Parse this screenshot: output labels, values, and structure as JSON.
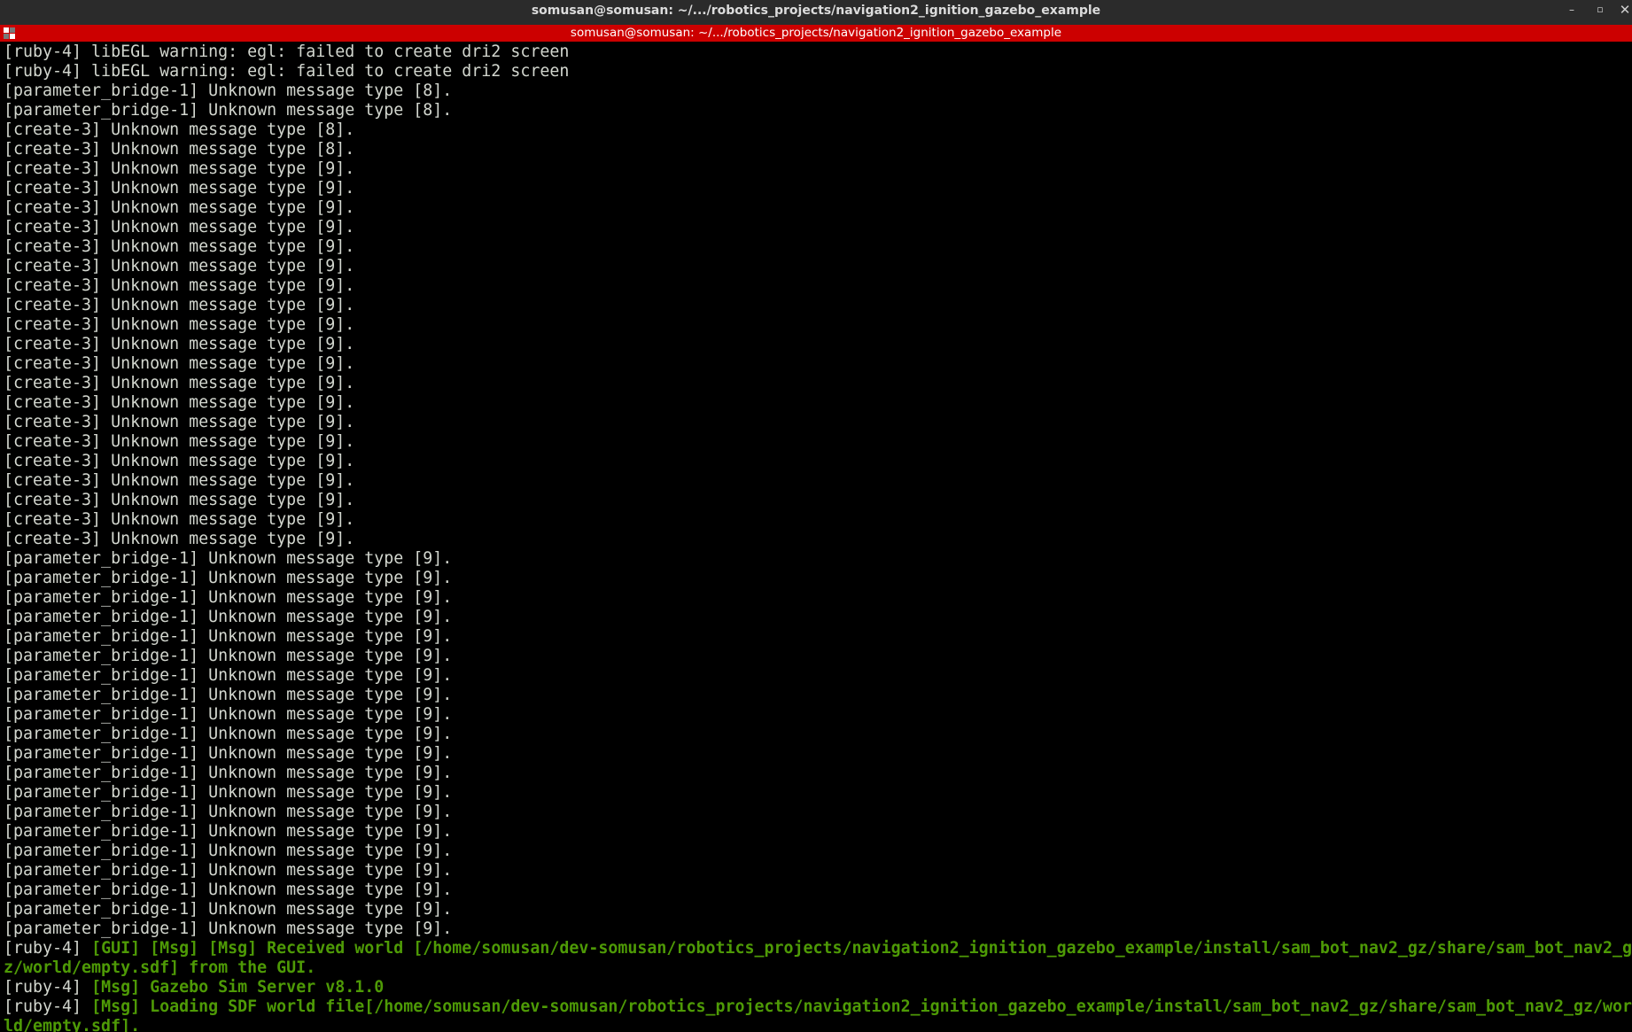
{
  "window": {
    "title": "somusan@somusan: ~/.../robotics_projects/navigation2_ignition_gazebo_example",
    "controls": {
      "minimize_icon": "–",
      "maximize_icon": "▫",
      "close_icon": "✕"
    }
  },
  "tab": {
    "title": "somusan@somusan: ~/.../robotics_projects/navigation2_ignition_gazebo_example",
    "icon": "terminal-icon"
  },
  "colors": {
    "background": "#000000",
    "tab_bar": "#cc0000",
    "text": "#d3d7cf",
    "highlight": "#4e9a06"
  },
  "log_lines": [
    [
      {
        "t": "[ruby-4] libEGL warning: egl: failed to create dri2 screen",
        "c": "plain"
      }
    ],
    [
      {
        "t": "[ruby-4] libEGL warning: egl: failed to create dri2 screen",
        "c": "plain"
      }
    ],
    [
      {
        "t": "[parameter_bridge-1] Unknown message type [8].",
        "c": "plain"
      }
    ],
    [
      {
        "t": "[parameter_bridge-1] Unknown message type [8].",
        "c": "plain"
      }
    ],
    [
      {
        "t": "[create-3] Unknown message type [8].",
        "c": "plain"
      }
    ],
    [
      {
        "t": "[create-3] Unknown message type [8].",
        "c": "plain"
      }
    ],
    [
      {
        "t": "[create-3] Unknown message type [9].",
        "c": "plain"
      }
    ],
    [
      {
        "t": "[create-3] Unknown message type [9].",
        "c": "plain"
      }
    ],
    [
      {
        "t": "[create-3] Unknown message type [9].",
        "c": "plain"
      }
    ],
    [
      {
        "t": "[create-3] Unknown message type [9].",
        "c": "plain"
      }
    ],
    [
      {
        "t": "[create-3] Unknown message type [9].",
        "c": "plain"
      }
    ],
    [
      {
        "t": "[create-3] Unknown message type [9].",
        "c": "plain"
      }
    ],
    [
      {
        "t": "[create-3] Unknown message type [9].",
        "c": "plain"
      }
    ],
    [
      {
        "t": "[create-3] Unknown message type [9].",
        "c": "plain"
      }
    ],
    [
      {
        "t": "[create-3] Unknown message type [9].",
        "c": "plain"
      }
    ],
    [
      {
        "t": "[create-3] Unknown message type [9].",
        "c": "plain"
      }
    ],
    [
      {
        "t": "[create-3] Unknown message type [9].",
        "c": "plain"
      }
    ],
    [
      {
        "t": "[create-3] Unknown message type [9].",
        "c": "plain"
      }
    ],
    [
      {
        "t": "[create-3] Unknown message type [9].",
        "c": "plain"
      }
    ],
    [
      {
        "t": "[create-3] Unknown message type [9].",
        "c": "plain"
      }
    ],
    [
      {
        "t": "[create-3] Unknown message type [9].",
        "c": "plain"
      }
    ],
    [
      {
        "t": "[create-3] Unknown message type [9].",
        "c": "plain"
      }
    ],
    [
      {
        "t": "[create-3] Unknown message type [9].",
        "c": "plain"
      }
    ],
    [
      {
        "t": "[create-3] Unknown message type [9].",
        "c": "plain"
      }
    ],
    [
      {
        "t": "[create-3] Unknown message type [9].",
        "c": "plain"
      }
    ],
    [
      {
        "t": "[create-3] Unknown message type [9].",
        "c": "plain"
      }
    ],
    [
      {
        "t": "[parameter_bridge-1] Unknown message type [9].",
        "c": "plain"
      }
    ],
    [
      {
        "t": "[parameter_bridge-1] Unknown message type [9].",
        "c": "plain"
      }
    ],
    [
      {
        "t": "[parameter_bridge-1] Unknown message type [9].",
        "c": "plain"
      }
    ],
    [
      {
        "t": "[parameter_bridge-1] Unknown message type [9].",
        "c": "plain"
      }
    ],
    [
      {
        "t": "[parameter_bridge-1] Unknown message type [9].",
        "c": "plain"
      }
    ],
    [
      {
        "t": "[parameter_bridge-1] Unknown message type [9].",
        "c": "plain"
      }
    ],
    [
      {
        "t": "[parameter_bridge-1] Unknown message type [9].",
        "c": "plain"
      }
    ],
    [
      {
        "t": "[parameter_bridge-1] Unknown message type [9].",
        "c": "plain"
      }
    ],
    [
      {
        "t": "[parameter_bridge-1] Unknown message type [9].",
        "c": "plain"
      }
    ],
    [
      {
        "t": "[parameter_bridge-1] Unknown message type [9].",
        "c": "plain"
      }
    ],
    [
      {
        "t": "[parameter_bridge-1] Unknown message type [9].",
        "c": "plain"
      }
    ],
    [
      {
        "t": "[parameter_bridge-1] Unknown message type [9].",
        "c": "plain"
      }
    ],
    [
      {
        "t": "[parameter_bridge-1] Unknown message type [9].",
        "c": "plain"
      }
    ],
    [
      {
        "t": "[parameter_bridge-1] Unknown message type [9].",
        "c": "plain"
      }
    ],
    [
      {
        "t": "[parameter_bridge-1] Unknown message type [9].",
        "c": "plain"
      }
    ],
    [
      {
        "t": "[parameter_bridge-1] Unknown message type [9].",
        "c": "plain"
      }
    ],
    [
      {
        "t": "[parameter_bridge-1] Unknown message type [9].",
        "c": "plain"
      }
    ],
    [
      {
        "t": "[parameter_bridge-1] Unknown message type [9].",
        "c": "plain"
      }
    ],
    [
      {
        "t": "[parameter_bridge-1] Unknown message type [9].",
        "c": "plain"
      }
    ],
    [
      {
        "t": "[parameter_bridge-1] Unknown message type [9].",
        "c": "plain"
      }
    ],
    [
      {
        "t": "[ruby-4] ",
        "c": "plain"
      },
      {
        "t": "[GUI] [Msg] [Msg] Received world [/home/somusan/dev-somusan/robotics_projects/navigation2_ignition_gazebo_example/install/sam_bot_nav2_gz/share/sam_bot_nav2_g",
        "c": "green"
      }
    ],
    [
      {
        "t": "z/world/empty.sdf] from the GUI.",
        "c": "green"
      }
    ],
    [
      {
        "t": "[ruby-4] ",
        "c": "plain"
      },
      {
        "t": "[Msg] Gazebo Sim Server v8.1.0",
        "c": "green"
      }
    ],
    [
      {
        "t": "[ruby-4] ",
        "c": "plain"
      },
      {
        "t": "[Msg] Loading SDF world file[/home/somusan/dev-somusan/robotics_projects/navigation2_ignition_gazebo_example/install/sam_bot_nav2_gz/share/sam_bot_nav2_gz/wor",
        "c": "green"
      }
    ],
    [
      {
        "t": "ld/empty.sdf].",
        "c": "green"
      }
    ]
  ]
}
